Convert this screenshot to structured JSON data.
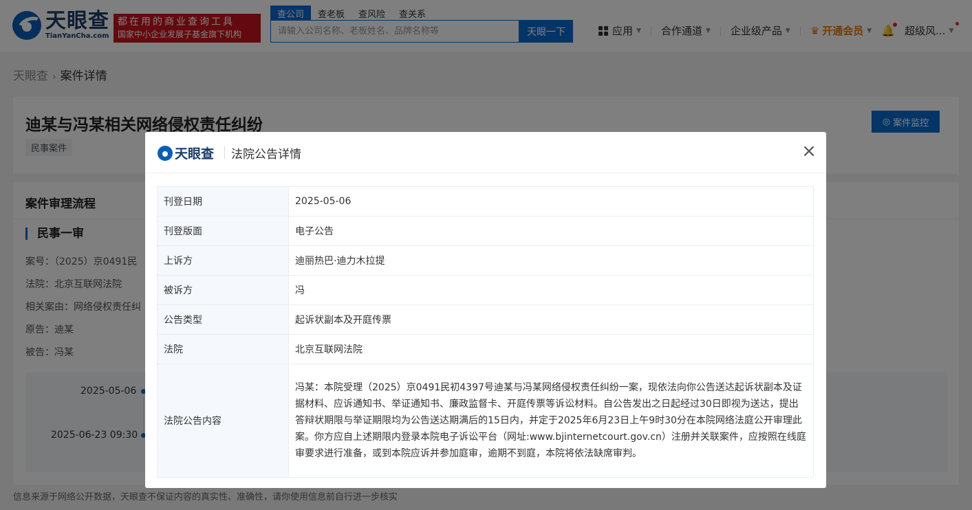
{
  "header": {
    "logo_cn": "天眼查",
    "logo_en": "TianYanCha.com",
    "slogan_line1": "都在用的商业查询工具",
    "slogan_line2": "国家中小企业发展子基金旗下机构",
    "search_tabs": [
      "查公司",
      "查老板",
      "查风险",
      "查关系"
    ],
    "search_placeholder": "请输入公司名称、老板姓名、品牌名称等",
    "search_button": "天眼一下",
    "nav": {
      "apps": "应用",
      "cooperation": "合作通道",
      "enterprise": "企业级产品",
      "vip": "开通会员",
      "user": "超级风..."
    }
  },
  "breadcrumb": {
    "home": "天眼查",
    "current": "案件详情"
  },
  "case": {
    "title": "迪某与冯某相关网络侵权责任纠纷",
    "tag": "民事案件",
    "monitor_button": "案件监控"
  },
  "process": {
    "title": "案件审理流程",
    "stage": "民事一审",
    "lines": [
      "案号：（2025）京0491民",
      "法院：北京互联网法院",
      "相关案由：网络侵权责任纠",
      "原告：迪某",
      "被告：冯某"
    ],
    "timeline": [
      "2025-05-06",
      "2025-06-23 09:30"
    ]
  },
  "footer_note": "信息来源于网络公开数据，天眼查不保证内容的真实性、准确性，请你使用信息前自行进一步核实",
  "modal": {
    "logo": "天眼查",
    "title": "法院公告详情",
    "rows": [
      {
        "key": "刊登日期",
        "value": "2025-05-06"
      },
      {
        "key": "刊登版面",
        "value": "电子公告"
      },
      {
        "key": "上诉方",
        "value": "迪丽热巴·迪力木拉提"
      },
      {
        "key": "被诉方",
        "value": "冯"
      },
      {
        "key": "公告类型",
        "value": "起诉状副本及开庭传票"
      },
      {
        "key": "法院",
        "value": "北京互联网法院"
      },
      {
        "key": "法院公告内容",
        "value": "冯某：本院受理（2025）京0491民初4397号迪某与冯某网络侵权责任纠纷一案，现依法向你公告送达起诉状副本及证据材料、应诉通知书、举证通知书、廉政监督卡、开庭传票等诉讼材料。自公告发出之日起经过30日即视为送达，提出答辩状期限与举证期限均为公告送达期满后的15日内，并定于2025年6月23日上午9时30分在本院网络法庭公开审理此案。你方应自上述期限内登录本院电子诉讼平台（网址:www.bjinternetcourt.gov.cn）注册并关联案件，应按照在线庭审要求进行准备，或到本院应诉并参加庭审，逾期不到庭，本院将依法缺席审判。"
      }
    ]
  },
  "colors": {
    "brand_blue": "#0a6acf",
    "slogan_red": "#c9151e",
    "vip_orange": "#e8760c"
  }
}
